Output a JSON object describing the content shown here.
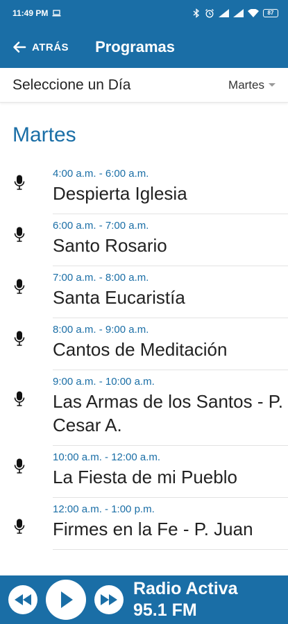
{
  "status_bar": {
    "time": "11:49 PM",
    "battery": "87"
  },
  "app_bar": {
    "back_label": "ATRÁS",
    "title": "Programas"
  },
  "day_selector": {
    "label": "Seleccione un Día",
    "selected": "Martes"
  },
  "day_heading": "Martes",
  "programs": [
    {
      "time": "4:00 a.m. - 6:00 a.m.",
      "title": "Despierta Iglesia"
    },
    {
      "time": "6:00 a.m. - 7:00 a.m.",
      "title": "Santo Rosario"
    },
    {
      "time": "7:00 a.m. - 8:00 a.m.",
      "title": "Santa Eucaristía"
    },
    {
      "time": "8:00 a.m. - 9:00 a.m.",
      "title": "Cantos de Meditación"
    },
    {
      "time": "9:00 a.m. - 10:00 a.m.",
      "title": "Las Armas de los Santos - P. Cesar A."
    },
    {
      "time": "10:00 a.m. - 12:00 a.m.",
      "title": "La Fiesta de mi Pueblo"
    },
    {
      "time": "12:00 a.m. - 1:00 p.m.",
      "title": "Firmes en la Fe - P. Juan"
    }
  ],
  "player": {
    "station_line1": "Radio Activa",
    "station_line2": "95.1 FM"
  },
  "colors": {
    "primary": "#1a6ea6",
    "text": "#222222",
    "divider": "#e2e2e2"
  },
  "icons": [
    "laptop-icon",
    "bluetooth-icon",
    "alarm-icon",
    "signal-icon",
    "wifi-icon",
    "battery-icon",
    "back-arrow-icon",
    "mic-icon",
    "rewind-icon",
    "play-icon",
    "fast-forward-icon"
  ]
}
